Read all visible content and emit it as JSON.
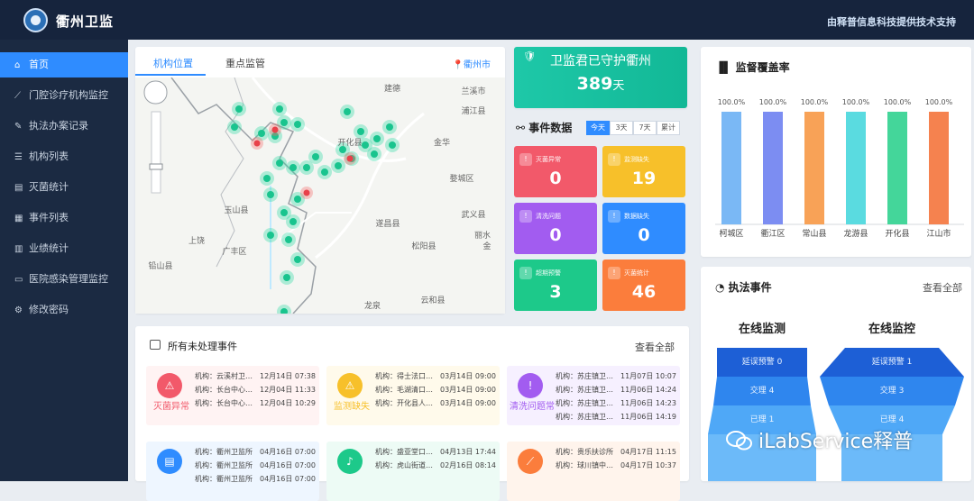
{
  "app": {
    "title": "衢州卫监",
    "vendor": "由释普信息科技提供技术支持"
  },
  "sidebar": {
    "items": [
      {
        "label": "首页",
        "icon": "home-icon",
        "active": true
      },
      {
        "label": "门腔诊疗机构监控",
        "icon": "line-chart-icon"
      },
      {
        "label": "执法办案记录",
        "icon": "edit-icon"
      },
      {
        "label": "机构列表",
        "icon": "list-icon"
      },
      {
        "label": "灭菌统计",
        "icon": "file-icon"
      },
      {
        "label": "事件列表",
        "icon": "document-icon"
      },
      {
        "label": "业绩统计",
        "icon": "bar-chart-icon"
      },
      {
        "label": "医院感染管理监控",
        "icon": "monitor-icon"
      },
      {
        "label": "修改密码",
        "icon": "settings-icon"
      }
    ]
  },
  "map_panel": {
    "tabs": [
      "机构位置",
      "重点监管"
    ],
    "city": "衢州市",
    "place_labels": [
      "建德",
      "兰溪市",
      "金华",
      "浦江县",
      "婺城区",
      "武义县",
      "金",
      "开化县",
      "玉山县",
      "上饶",
      "广丰区",
      "遂昌县",
      "松阳县",
      "丽水",
      "铅山县",
      "云和县",
      "龙泉"
    ]
  },
  "guard": {
    "title": "卫监君已守护衢州",
    "days": "389",
    "unit": "天"
  },
  "events": {
    "title": "事件数据",
    "ranges": [
      "今天",
      "3天",
      "7天",
      "累计"
    ],
    "tiles": [
      {
        "label": "灭菌异常",
        "value": "0",
        "color": "#f2596a"
      },
      {
        "label": "监测缺失",
        "value": "19",
        "color": "#f7c02a"
      },
      {
        "label": "清洗问题",
        "value": "0",
        "color": "#a25cf0"
      },
      {
        "label": "数据缺失",
        "value": "0",
        "color": "#2f8cff"
      },
      {
        "label": "超期预警",
        "value": "3",
        "color": "#1dc98a"
      },
      {
        "label": "灭菌统计",
        "value": "46",
        "color": "#fb7d3c"
      }
    ]
  },
  "coverage": {
    "title": "监督覆盖率"
  },
  "chart_data": {
    "type": "bar",
    "title": "监督覆盖率",
    "categories": [
      "柯城区",
      "衢江区",
      "常山县",
      "龙游县",
      "开化县",
      "江山市"
    ],
    "values": [
      100.0,
      100.0,
      100.0,
      100.0,
      100.0,
      100.0
    ],
    "value_labels": [
      "100.0%",
      "100.0%",
      "100.0%",
      "100.0%",
      "100.0%",
      "100.0%"
    ],
    "colors": [
      "#7ab8f5",
      "#7c8df2",
      "#f8a257",
      "#5adbe0",
      "#44d69a",
      "#f5824f"
    ],
    "ylim": [
      0,
      100
    ]
  },
  "enforcement": {
    "title": "执法事件",
    "view_all": "查看全部",
    "funnels": [
      {
        "title": "在线监测",
        "labels": [
          "延误预警 0",
          "交理 4",
          "已理 1"
        ]
      },
      {
        "title": "在线监控",
        "labels": [
          "延误预警 1",
          "交理 3",
          "已理 4"
        ]
      }
    ]
  },
  "unhandled": {
    "title": "所有未处理事件",
    "view_all": "查看全部",
    "boxes": [
      {
        "label": "灭菌异常",
        "icon": "alarm-icon",
        "color": "#f2596a",
        "bg": "#fff3f3",
        "rows": [
          {
            "org": "机构：云溪村卫…",
            "time": "12月14日 07:38"
          },
          {
            "org": "机构：长台中心…",
            "time": "12月04日 11:33"
          },
          {
            "org": "机构：长台中心…",
            "time": "12月04日 10:29"
          }
        ]
      },
      {
        "label": "监测缺失",
        "icon": "alarm-icon",
        "color": "#f7c02a",
        "bg": "#fffaeb",
        "rows": [
          {
            "org": "机构：得士法口…",
            "time": "03月14日 09:00"
          },
          {
            "org": "机构：毛湖清口…",
            "time": "03月14日 09:00"
          },
          {
            "org": "机构：开化县人…",
            "time": "03月14日 09:00"
          }
        ]
      },
      {
        "label": "清洗问题常",
        "icon": "warning-icon",
        "color": "#a25cf0",
        "bg": "#f6f0ff",
        "rows": [
          {
            "org": "机构：苏庄镇卫…",
            "time": "11月07日 10:07"
          },
          {
            "org": "机构：苏庄镇卫…",
            "time": "11月06日 14:24"
          },
          {
            "org": "机构：苏庄镇卫…",
            "time": "11月06日 14:23"
          },
          {
            "org": "机构：苏庄镇卫…",
            "time": "11月06日 14:19"
          }
        ]
      },
      {
        "label": "",
        "icon": "document-icon",
        "color": "#2f8cff",
        "bg": "#eef6ff",
        "rows": [
          {
            "org": "机构：衢州卫监所",
            "time": "04月16日 07:00"
          },
          {
            "org": "机构：衢州卫监所",
            "time": "04月16日 07:00"
          },
          {
            "org": "机构：衢州卫监所",
            "time": "04月16日 07:00"
          }
        ]
      },
      {
        "label": "",
        "icon": "bell-icon",
        "color": "#1dc98a",
        "bg": "#edfbf5",
        "rows": [
          {
            "org": "机构：盛亚堂口…",
            "time": "04月13日 17:44"
          },
          {
            "org": "机构：虎山街道…",
            "time": "02月16日 08:14"
          }
        ]
      },
      {
        "label": "",
        "icon": "chart-icon",
        "color": "#fb7d3c",
        "bg": "#fff4ec",
        "rows": [
          {
            "org": "机构：贵乐扶诊所",
            "time": "04月17日 11:15"
          },
          {
            "org": "机构：球川镇中…",
            "time": "04月17日 10:37"
          }
        ]
      }
    ]
  },
  "watermark": {
    "text": "iLabService释普",
    "icon": "wechat-icon"
  }
}
